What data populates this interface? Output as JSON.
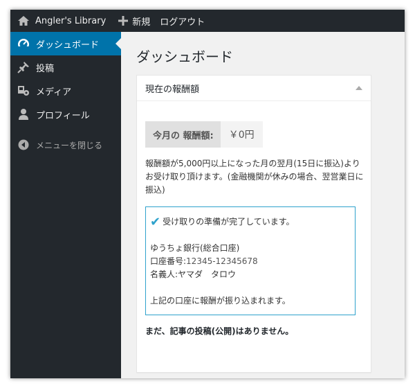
{
  "adminbar": {
    "site_name": "Angler's Library",
    "new_label": "新規",
    "logout_label": "ログアウト"
  },
  "sidebar": {
    "items": [
      {
        "label": "ダッシュボード",
        "icon": "dashboard-icon",
        "current": true
      },
      {
        "label": "投稿",
        "icon": "pin-icon"
      },
      {
        "label": "メディア",
        "icon": "media-icon"
      },
      {
        "label": "プロフィール",
        "icon": "user-icon"
      }
    ],
    "collapse_label": "メニューを閉じる"
  },
  "main": {
    "title": "ダッシュボード",
    "widget": {
      "title": "現在の報酬額",
      "reward_label": "今月の 報酬額:",
      "reward_value": "￥0円",
      "note": "報酬額が5,000円以上になった月の翌月(15日に振込)よりお受け取り頂けます。(金融機関が休みの場合、翌営業日に振込)",
      "bank": {
        "ready_text": "受け取りの準備が完了しています。",
        "bank_name": "ゆうちょ銀行(総合口座)",
        "account_label": "口座番号:",
        "account_number": "12345-12345678",
        "holder": "名義人:ヤマダ　タロウ",
        "transfer_note": "上記の口座に報酬が振り込まれます。"
      },
      "no_posts": "まだ、記事の投稿(公開)はありません。"
    }
  },
  "colors": {
    "adminbar_bg": "#23282d",
    "accent": "#0073aa",
    "box_border": "#2ea2cc"
  }
}
